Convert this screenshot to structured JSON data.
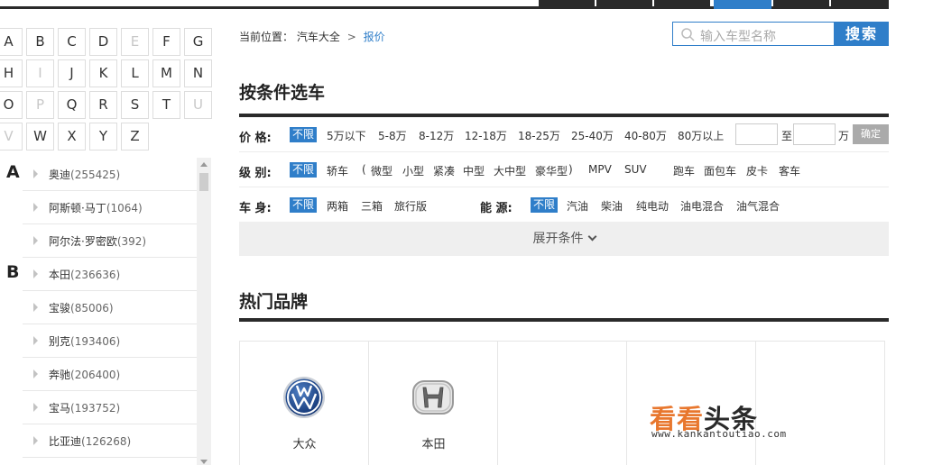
{
  "letters": [
    {
      "l": "A",
      "disabled": false
    },
    {
      "l": "B",
      "disabled": false
    },
    {
      "l": "C",
      "disabled": false
    },
    {
      "l": "D",
      "disabled": false
    },
    {
      "l": "E",
      "disabled": true
    },
    {
      "l": "F",
      "disabled": false
    },
    {
      "l": "G",
      "disabled": false
    },
    {
      "l": "H",
      "disabled": false
    },
    {
      "l": "I",
      "disabled": true
    },
    {
      "l": "J",
      "disabled": false
    },
    {
      "l": "K",
      "disabled": false
    },
    {
      "l": "L",
      "disabled": false
    },
    {
      "l": "M",
      "disabled": false
    },
    {
      "l": "N",
      "disabled": false
    },
    {
      "l": "O",
      "disabled": false
    },
    {
      "l": "P",
      "disabled": true
    },
    {
      "l": "Q",
      "disabled": false
    },
    {
      "l": "R",
      "disabled": false
    },
    {
      "l": "S",
      "disabled": false
    },
    {
      "l": "T",
      "disabled": false
    },
    {
      "l": "U",
      "disabled": true
    },
    {
      "l": "V",
      "disabled": true
    },
    {
      "l": "W",
      "disabled": false
    },
    {
      "l": "X",
      "disabled": false
    },
    {
      "l": "Y",
      "disabled": false
    },
    {
      "l": "Z",
      "disabled": false
    }
  ],
  "brand_groups": [
    {
      "letter": "A",
      "brands": [
        {
          "name": "奥迪",
          "count": "(255425)"
        },
        {
          "name": "阿斯顿·马丁",
          "count": "(1064)"
        },
        {
          "name": "阿尔法·罗密欧",
          "count": "(392)"
        }
      ]
    },
    {
      "letter": "B",
      "brands": [
        {
          "name": "本田",
          "count": "(236636)"
        },
        {
          "name": "宝骏",
          "count": "(85006)"
        },
        {
          "name": "别克",
          "count": "(193406)"
        },
        {
          "name": "奔驰",
          "count": "(206400)"
        },
        {
          "name": "宝马",
          "count": "(193752)"
        },
        {
          "name": "比亚迪",
          "count": "(126268)"
        }
      ]
    }
  ],
  "breadcrumb": {
    "prefix": "当前位置：",
    "home": "汽车大全",
    "sep": ">",
    "current": "报价"
  },
  "search": {
    "placeholder": "输入车型名称",
    "button": "搜索"
  },
  "filter_section_title": "按条件选车",
  "filters": {
    "price": {
      "label": "价  格:",
      "options": [
        "不限",
        "5万以下",
        "5-8万",
        "8-12万",
        "12-18万",
        "18-25万",
        "25-40万",
        "40-80万",
        "80万以上"
      ],
      "selected": "不限",
      "range_to": "至",
      "unit": "万",
      "confirm": "确定"
    },
    "level": {
      "label": "级  别:",
      "options": [
        "不限",
        "轿车",
        "(",
        "微型",
        "小型",
        "紧凑",
        "中型",
        "大中型",
        "豪华型",
        ")",
        "MPV",
        "SUV",
        "跑车",
        "面包车",
        "皮卡",
        "客车"
      ],
      "selected": "不限"
    },
    "body": {
      "label": "车  身:",
      "options": [
        "不限",
        "两箱",
        "三箱",
        "旅行版"
      ],
      "selected": "不限"
    },
    "energy": {
      "label": "能  源:",
      "options": [
        "不限",
        "汽油",
        "柴油",
        "纯电动",
        "油电混合",
        "油气混合"
      ],
      "selected": "不限"
    }
  },
  "expand_label": "展开条件",
  "hot_section_title": "热门品牌",
  "hot_brands": [
    {
      "name": "大众",
      "logo": "volkswagen-logo"
    },
    {
      "name": "本田",
      "logo": "honda-logo"
    },
    {
      "name": "",
      "logo": ""
    },
    {
      "name": "",
      "logo": ""
    },
    {
      "name": "",
      "logo": ""
    }
  ],
  "watermark": {
    "part1": "看看",
    "part2": "头条",
    "url": "www.kankantoutiao.com"
  },
  "colors": {
    "accent": "#2f7ec9",
    "dark": "#2a2a2a",
    "watermark_orange": "#e8772e"
  }
}
